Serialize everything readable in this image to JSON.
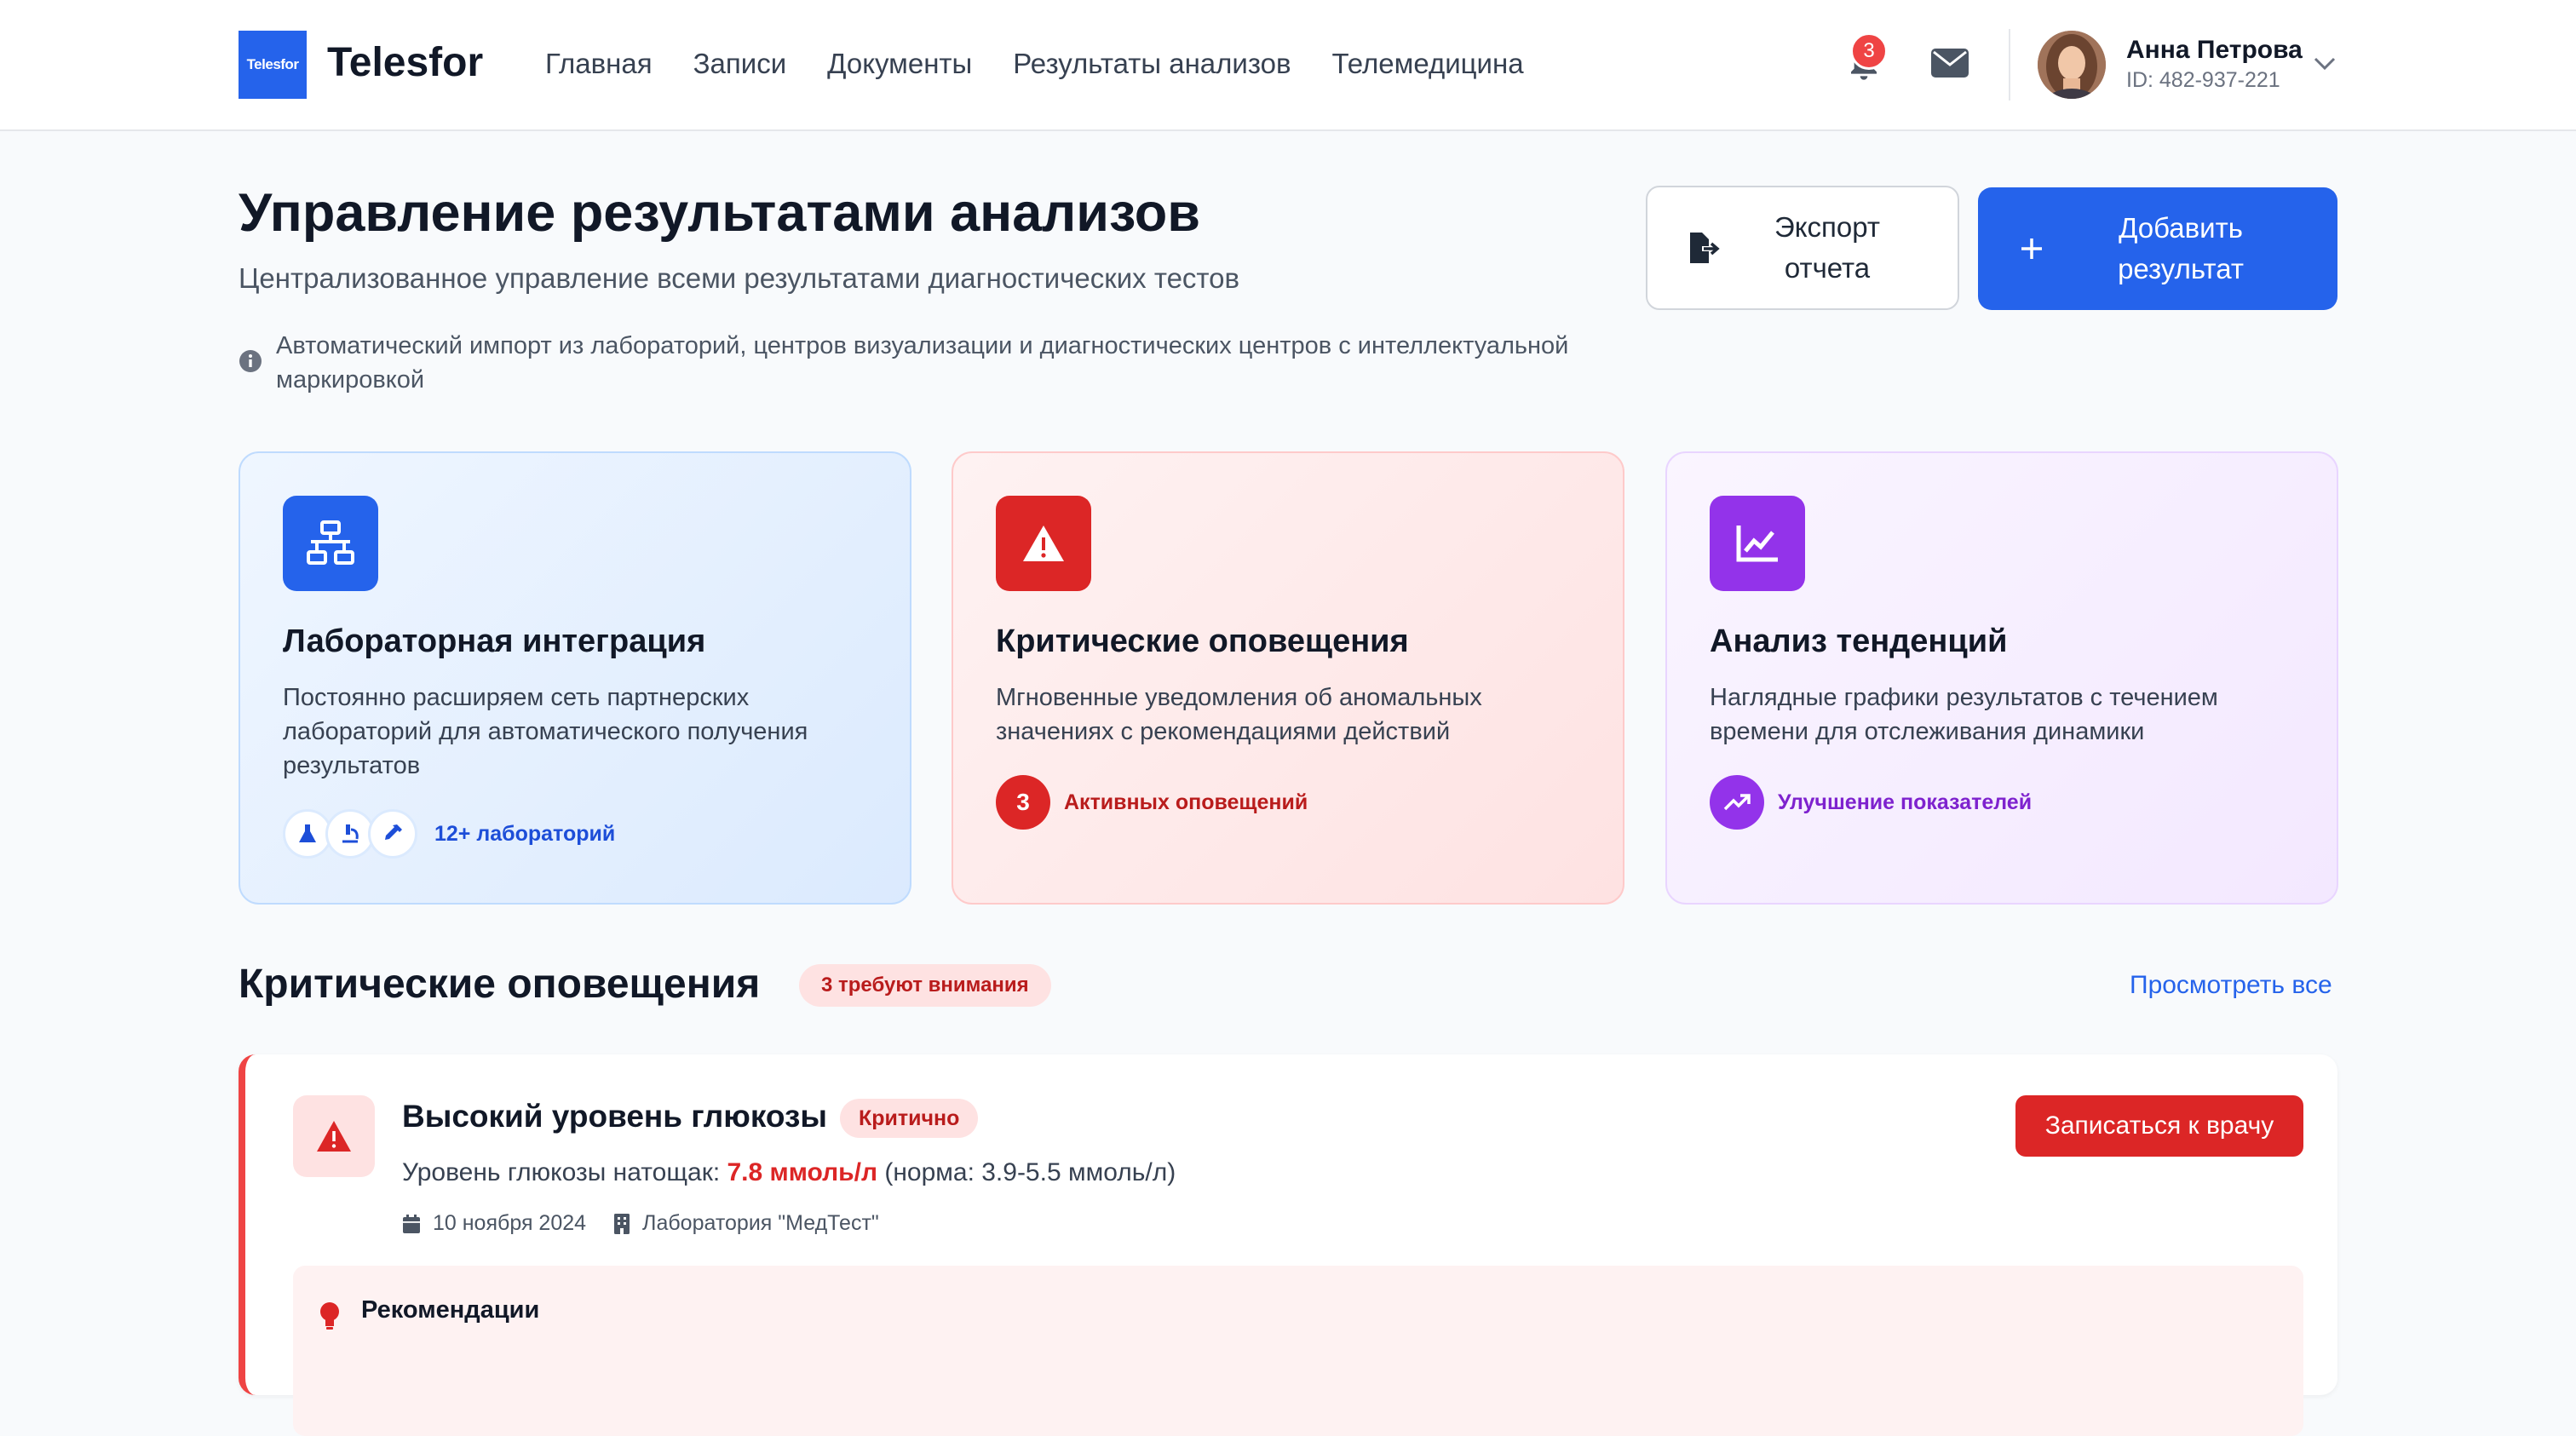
{
  "nav": {
    "logo_text": "Telesfor",
    "brand": "Telesfor",
    "links": [
      "Главная",
      "Записи",
      "Документы",
      "Результаты анализов",
      "Телемедицина"
    ],
    "notifications_count": "3",
    "user": {
      "name": "Анна Петрова",
      "id": "ID: 482-937-221"
    }
  },
  "header": {
    "title": "Управление результатами анализов",
    "subtitle": "Централизованное управление всеми результатами диагностических тестов",
    "info": "Автоматический импорт из лабораторий, центров визуализации и диагностических центров с интеллектуальной маркировкой",
    "export_label": "Экспорт отчета",
    "add_label": "Добавить результат"
  },
  "cards": [
    {
      "title": "Лабораторная интеграция",
      "desc": "Постоянно расширяем сеть партнерских лабораторий для автоматического получения результатов",
      "foot": "12+ лабораторий",
      "color": "#2563eb",
      "icon": "network-icon"
    },
    {
      "title": "Критические оповещения",
      "desc": "Мгновенные уведомления об аномальных значениях с рекомендациями действий",
      "foot_num": "3",
      "foot": "Активных оповещений",
      "color": "#dc2626",
      "icon": "warning-icon"
    },
    {
      "title": "Анализ тенденций",
      "desc": "Наглядные графики результатов с течением времени для отслеживания динамики",
      "foot": "Улучшение показателей",
      "color": "#9333ea",
      "icon": "chart-line-icon"
    }
  ],
  "alerts_section": {
    "title": "Критические оповещения",
    "badge": "3 требуют внимания",
    "view_all": "Просмотреть все"
  },
  "alert": {
    "title": "Высокий уровень глюкозы",
    "badge": "Критично",
    "line_prefix": "Уровень глюкозы натощак: ",
    "value": "7.8 ммоль/л",
    "norm": " (норма: 3.9-5.5 ммоль/л)",
    "date": "10 ноября 2024",
    "lab": "Лаборатория \"МедТест\"",
    "button": "Записаться к врачу",
    "rec_title": "Рекомендации"
  }
}
